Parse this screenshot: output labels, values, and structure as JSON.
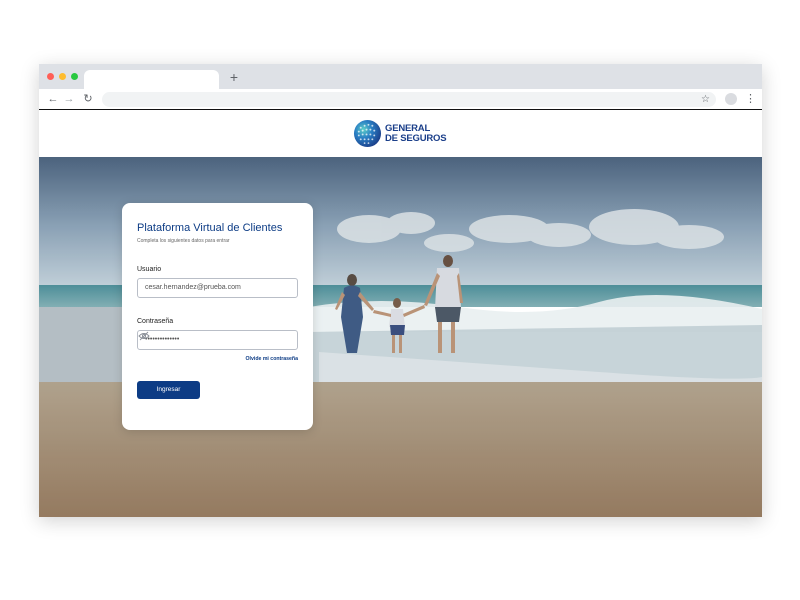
{
  "browser": {
    "tab_title": "",
    "new_tab_label": "+",
    "address": "",
    "icons": [
      "back-arrow-icon",
      "forward-arrow-icon",
      "reload-icon",
      "star-icon",
      "profile-icon",
      "kebab-menu-icon"
    ]
  },
  "brand": {
    "name_line1": "GENERAL",
    "name_line2": "DE SEGUROS",
    "color": "#1b3f8a"
  },
  "login": {
    "title": "Plataforma Virtual de Clientes",
    "subtitle": "Completa los siguientes datos para entrar",
    "user_label": "Usuario",
    "user_value": "cesar.hernandez@prueba.com",
    "password_label": "Contraseña",
    "password_value": "••••••••••••••",
    "forgot_link": "Olvide mi contraseña",
    "submit_label": "Ingresar",
    "accent_color": "#0d3c85"
  }
}
